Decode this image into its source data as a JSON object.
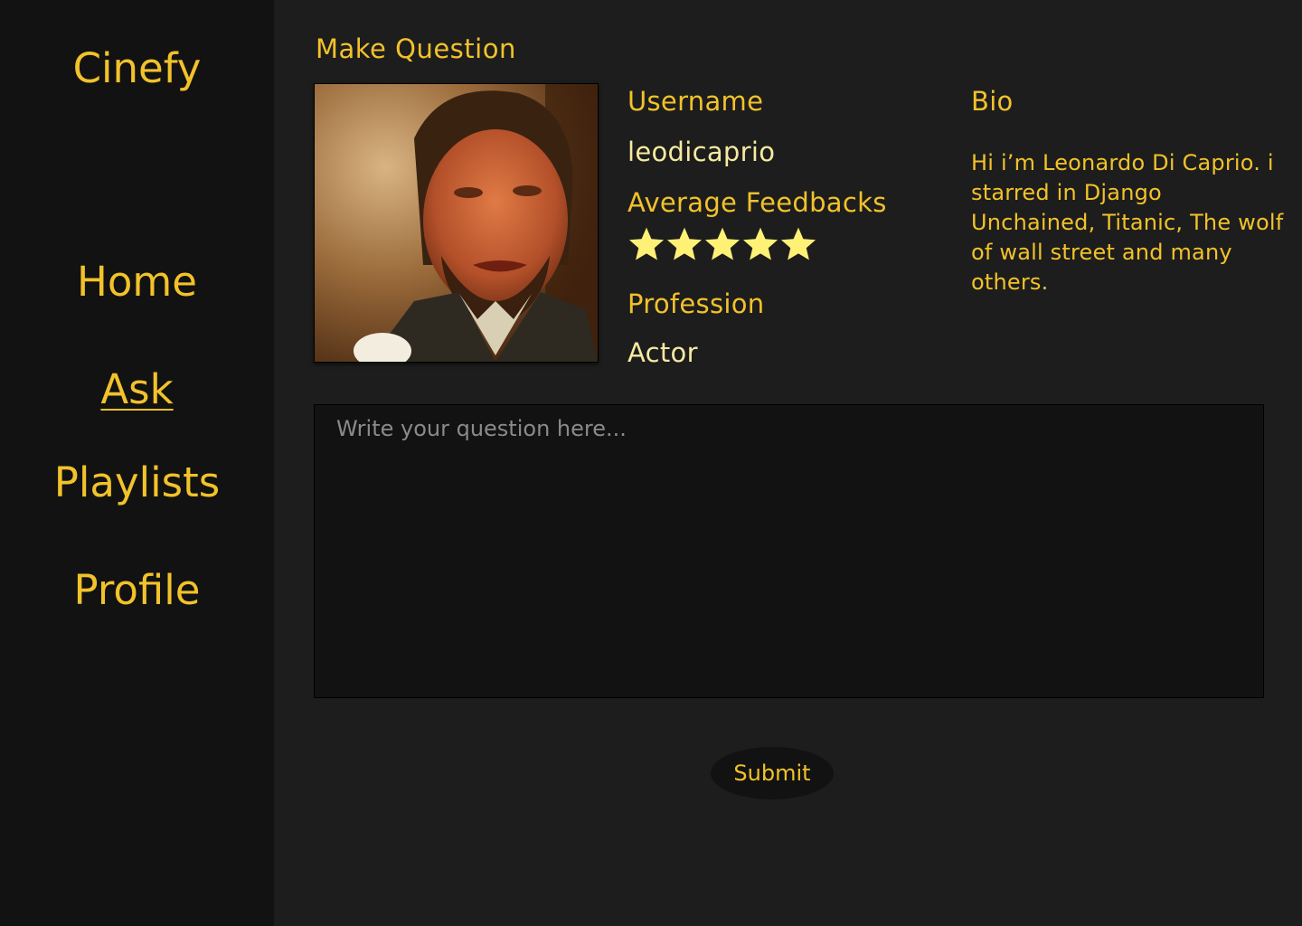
{
  "sidebar": {
    "brand": "Cinefy",
    "items": [
      {
        "label": "Home"
      },
      {
        "label": "Ask"
      },
      {
        "label": "Playlists"
      },
      {
        "label": "Profile"
      }
    ],
    "active_item": "Ask"
  },
  "main": {
    "title": "Make Question",
    "profile": {
      "avatar_icon": "profile-photo",
      "username_label": "Username",
      "username": "leodicaprio",
      "feedback_label": "Average Feedbacks",
      "rating": 5,
      "rating_max": 5,
      "profession_label": "Profession",
      "profession": "Actor",
      "bio_label": "Bio",
      "bio": "Hi i’m Leonardo Di Caprio. i starred in Django Unchained, Titanic, The wolf of wall street and many others."
    },
    "question": {
      "placeholder": "Write your question here...",
      "value": ""
    },
    "submit_label": "Submit"
  },
  "colors": {
    "accent": "#f2c22a",
    "star": "#fff176",
    "background": "#1d1d1d",
    "sidebar": "#121212"
  }
}
